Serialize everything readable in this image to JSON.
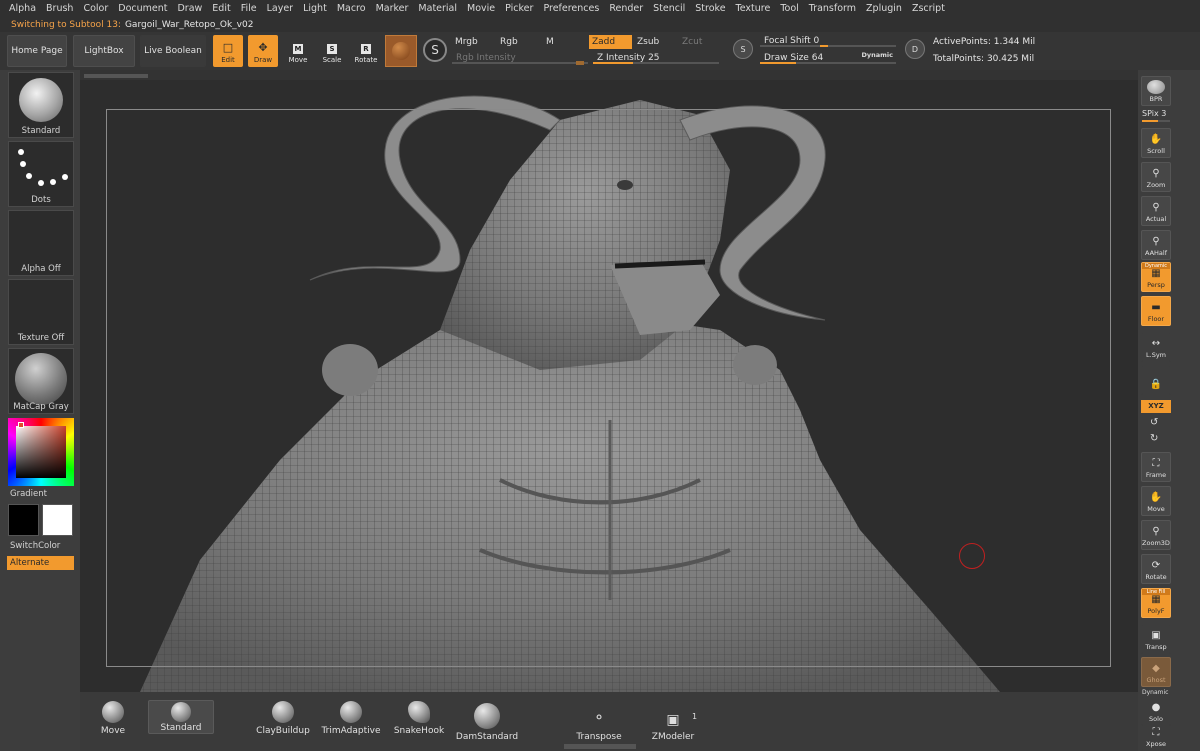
{
  "menu": [
    "Alpha",
    "Brush",
    "Color",
    "Document",
    "Draw",
    "Edit",
    "File",
    "Layer",
    "Light",
    "Macro",
    "Marker",
    "Material",
    "Movie",
    "Picker",
    "Preferences",
    "Render",
    "Stencil",
    "Stroke",
    "Texture",
    "Tool",
    "Transform",
    "Zplugin",
    "Zscript"
  ],
  "title": {
    "prefix": "Switching to Subtool 13:",
    "name": "Gargoil_War_Retopo_Ok_v02"
  },
  "shelf": {
    "home": "Home Page",
    "lightbox": "LightBox",
    "live_boolean": "Live Boolean",
    "edit": "Edit",
    "draw": "Draw",
    "move": "Move",
    "scale": "Scale",
    "rotate": "Rotate",
    "mrgb": "Mrgb",
    "rgb": "Rgb",
    "m": "M",
    "zadd": "Zadd",
    "zsub": "Zsub",
    "zcut": "Zcut",
    "rgb_intensity": "Rgb Intensity",
    "z_intensity_label": "Z Intensity",
    "z_intensity": "25",
    "focal_shift_label": "Focal Shift",
    "focal_shift": "0",
    "draw_size_label": "Draw Size",
    "draw_size": "64",
    "dynamic": "Dynamic",
    "s_key": "S",
    "d_key": "D",
    "active_points": "ActivePoints: 1.344 Mil",
    "total_points": "TotalPoints: 30.425 Mil"
  },
  "left": {
    "brush": "Standard",
    "stroke": "Dots",
    "alpha": "Alpha Off",
    "texture": "Texture Off",
    "material": "MatCap Gray",
    "gradient": "Gradient",
    "switch_color": "SwitchColor",
    "alternate": "Alternate"
  },
  "right": {
    "bpr": "BPR",
    "spix_label": "SPix",
    "spix": "3",
    "buttons": [
      "Scroll",
      "Zoom",
      "Actual",
      "AAHalf",
      "Persp",
      "Floor",
      "L.Sym",
      "",
      "Frame",
      "Move",
      "Zoom3D",
      "Rotate",
      "PolyF",
      "Transp",
      "Ghost",
      "Solo",
      "Xpose"
    ],
    "dynamic_tag": "Dynamic",
    "linefill_tag": "Line Fill",
    "xyz": "XYZ",
    "dynamic_tag2": "Dynamic"
  },
  "bottom": {
    "brushes": [
      "Move",
      "Standard",
      "ClayBuildup",
      "TrimAdaptive",
      "SnakeHook",
      "DamStandard",
      "Transpose",
      "ZModeler"
    ],
    "count": "1"
  },
  "colors": {
    "accent": "#f29a2e",
    "bg": "#3c3c3c",
    "canvas": "#2d2d2d"
  }
}
